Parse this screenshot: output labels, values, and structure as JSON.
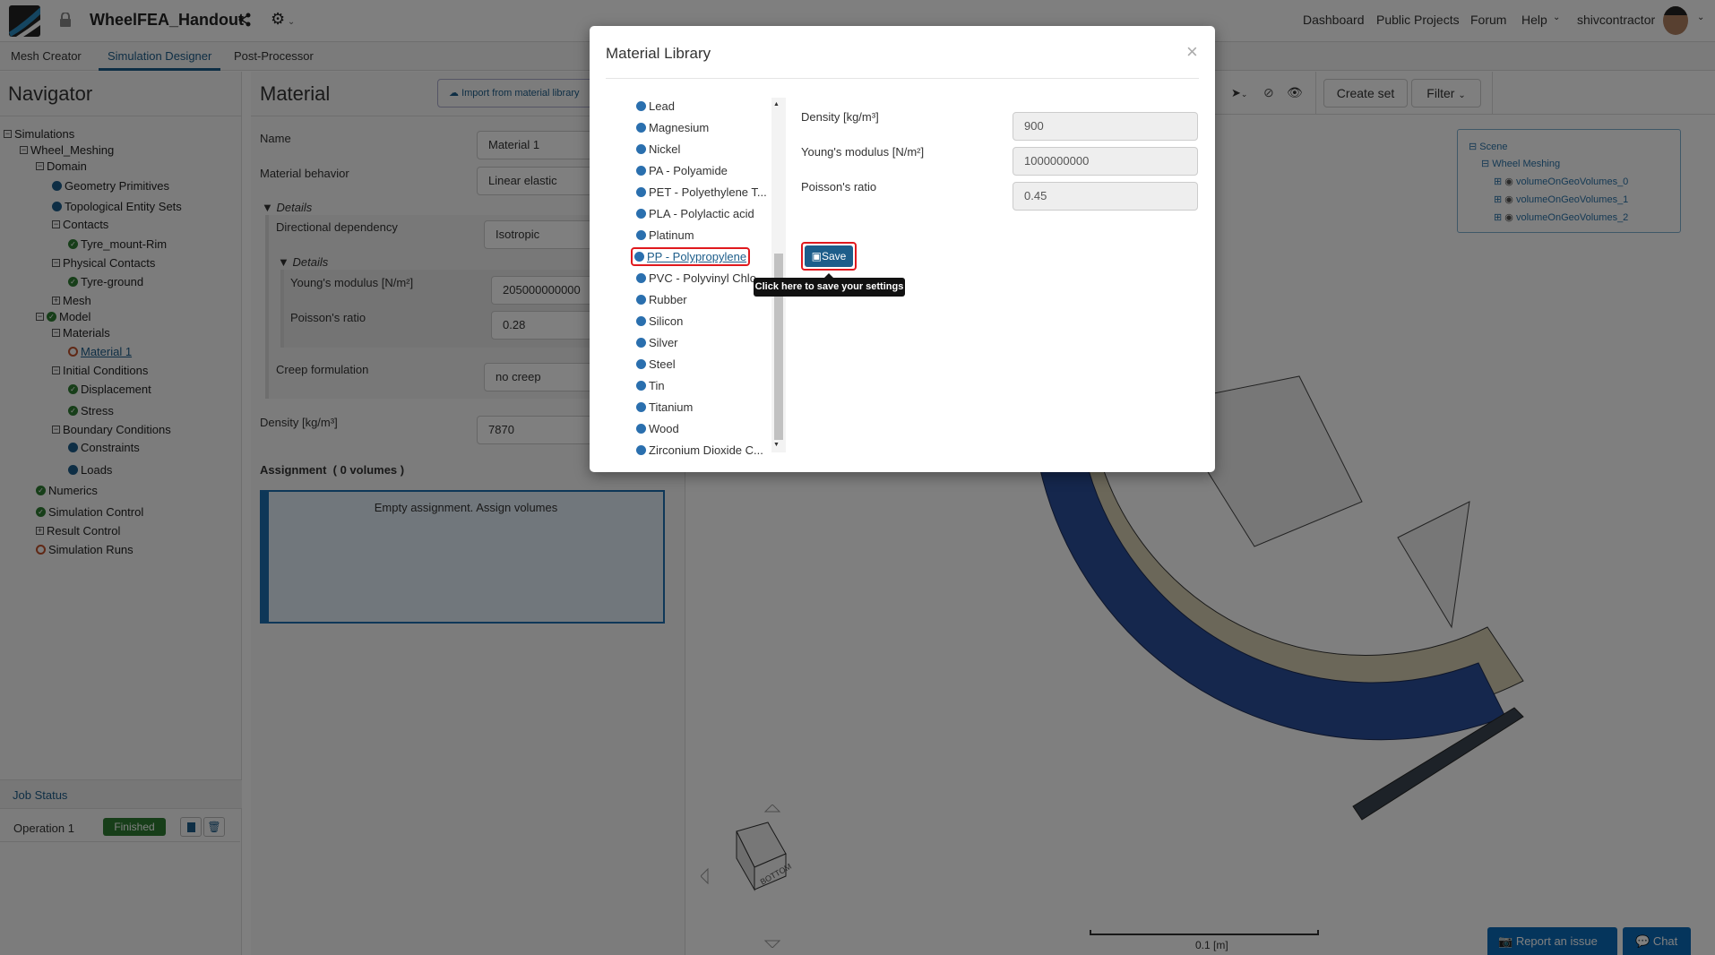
{
  "app": {
    "project_title": "WheelFEA_Handout",
    "nav_links": [
      "Dashboard",
      "Public Projects",
      "Forum",
      "Help"
    ],
    "username": "shivcontractor"
  },
  "tabs": [
    "Mesh Creator",
    "Simulation Designer",
    "Post-Processor"
  ],
  "navigator": {
    "title": "Navigator",
    "tree": [
      {
        "label": "Simulations",
        "level": 0,
        "icon": "minus-box"
      },
      {
        "label": "Wheel_Meshing",
        "level": 1,
        "icon": "minus-box"
      },
      {
        "label": "Domain",
        "level": 2,
        "icon": "minus-box"
      },
      {
        "label": "Geometry Primitives",
        "level": 3,
        "icon": "dot"
      },
      {
        "label": "Topological Entity Sets",
        "level": 3,
        "icon": "dot"
      },
      {
        "label": "Contacts",
        "level": 3,
        "icon": "minus-box"
      },
      {
        "label": "Tyre_mount-Rim",
        "level": 4,
        "icon": "check"
      },
      {
        "label": "Physical Contacts",
        "level": 3,
        "icon": "minus-box"
      },
      {
        "label": "Tyre-ground",
        "level": 4,
        "icon": "check"
      },
      {
        "label": "Mesh",
        "level": 3,
        "icon": "plus-box"
      },
      {
        "label": "Model",
        "level": 2,
        "icon": "minus-box-check"
      },
      {
        "label": "Materials",
        "level": 3,
        "icon": "minus-box"
      },
      {
        "label": "Material 1",
        "level": 4,
        "icon": "ring"
      },
      {
        "label": "Initial Conditions",
        "level": 3,
        "icon": "minus-box"
      },
      {
        "label": "Displacement",
        "level": 4,
        "icon": "check"
      },
      {
        "label": "Stress",
        "level": 4,
        "icon": "check"
      },
      {
        "label": "Boundary Conditions",
        "level": 3,
        "icon": "minus-box"
      },
      {
        "label": "Constraints",
        "level": 4,
        "icon": "dot"
      },
      {
        "label": "Loads",
        "level": 4,
        "icon": "dot"
      },
      {
        "label": "Numerics",
        "level": 2,
        "icon": "check"
      },
      {
        "label": "Simulation Control",
        "level": 2,
        "icon": "check"
      },
      {
        "label": "Result Control",
        "level": 2,
        "icon": "plus-box"
      },
      {
        "label": "Simulation Runs",
        "level": 2,
        "icon": "ring"
      }
    ],
    "job_status": {
      "title": "Job Status",
      "operation": "Operation 1",
      "status": "Finished"
    }
  },
  "material": {
    "title": "Material",
    "import_label": "Import from material library",
    "name_label": "Name",
    "name_value": "Material 1",
    "behavior_label": "Material behavior",
    "behavior_value": "Linear elastic",
    "details_label": "Details",
    "directional_label": "Directional dependency",
    "directional_value": "Isotropic",
    "inner_details_label": "Details",
    "youngs_label": "Young's modulus [N/m²]",
    "youngs_value": "205000000000",
    "poisson_label": "Poisson's ratio",
    "poisson_value": "0.28",
    "creep_label": "Creep formulation",
    "creep_value": "no creep",
    "density_label": "Density [kg/m³]",
    "density_value": "7870",
    "assignment_label": "Assignment",
    "assignment_count": "( 0 volumes )",
    "assignment_empty": "Empty assignment. Assign volumes"
  },
  "viewer": {
    "create_set": "Create set",
    "filter": "Filter",
    "scene_tree": [
      "Scene",
      "Wheel Meshing",
      "volumeOnGeoVolumes_0",
      "volumeOnGeoVolumes_1",
      "volumeOnGeoVolumes_2"
    ],
    "cube_face": "BOTTOM",
    "scale_label": "0.1 [m]",
    "report_issue": "Report an issue",
    "chat": "Chat"
  },
  "modal": {
    "title": "Material Library",
    "materials": [
      "Lead",
      "Magnesium",
      "Nickel",
      "PA - Polyamide",
      "PET - Polyethylene T...",
      "PLA - Polylactic acid",
      "Platinum",
      "PP - Polypropylene",
      "PVC - Polyvinyl Chlo...",
      "Rubber",
      "Silicon",
      "Silver",
      "Steel",
      "Tin",
      "Titanium",
      "Wood",
      "Zirconium Dioxide C..."
    ],
    "selected": "PP - Polypropylene",
    "density_label": "Density [kg/m³]",
    "density_value": "900",
    "youngs_label": "Young's modulus [N/m²]",
    "youngs_value": "1000000000",
    "poisson_label": "Poisson's ratio",
    "poisson_value": "0.45",
    "save_label": "Save",
    "tooltip": "Click here to save your settings"
  },
  "colors": {
    "brand": "#1d5d8a",
    "success": "#2e7d32",
    "highlight": "#e0191e"
  }
}
